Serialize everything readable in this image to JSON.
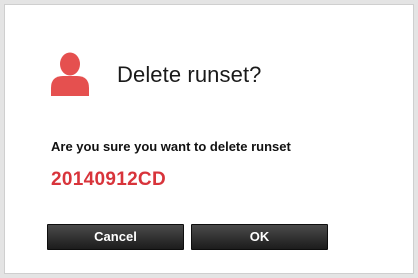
{
  "dialog": {
    "title": "Delete runset?",
    "icon": "user-icon",
    "message": "Are you sure you want to delete runset",
    "runset_name": "20140912CD",
    "cancel_label": "Cancel",
    "ok_label": "OK"
  },
  "colors": {
    "accent_red": "#d8343b",
    "icon_red": "#e5504f",
    "button_dark": "#2b2b2b"
  }
}
